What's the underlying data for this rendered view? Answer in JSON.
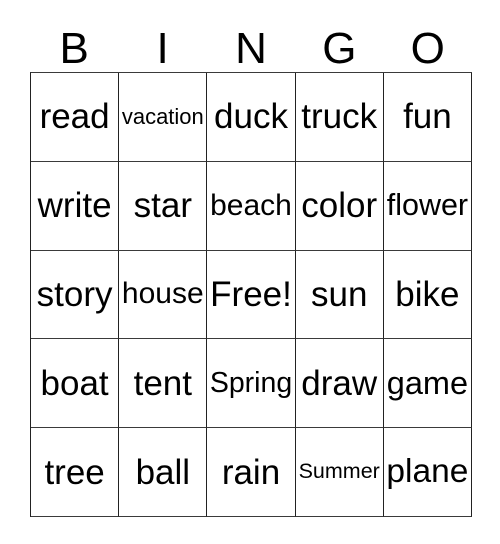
{
  "card": {
    "title": "Bingo Card",
    "header": {
      "letters": [
        "B",
        "I",
        "N",
        "G",
        "O"
      ]
    },
    "grid": {
      "columns": 5,
      "rows": 5,
      "free_space_label": "Free!",
      "free_space_position": {
        "row": 3,
        "column": 3
      },
      "cells": [
        [
          "read",
          "vacation",
          "duck",
          "truck",
          "fun"
        ],
        [
          "write",
          "star",
          "beach",
          "color",
          "flower"
        ],
        [
          "story",
          "house",
          "Free!",
          "sun",
          "bike"
        ],
        [
          "boat",
          "tent",
          "Spring",
          "draw",
          "game"
        ],
        [
          "tree",
          "ball",
          "rain",
          "Summer",
          "plane"
        ]
      ]
    },
    "colors": {
      "background": "#ffffff",
      "text": "#000000",
      "grid_line": "#222222"
    }
  }
}
